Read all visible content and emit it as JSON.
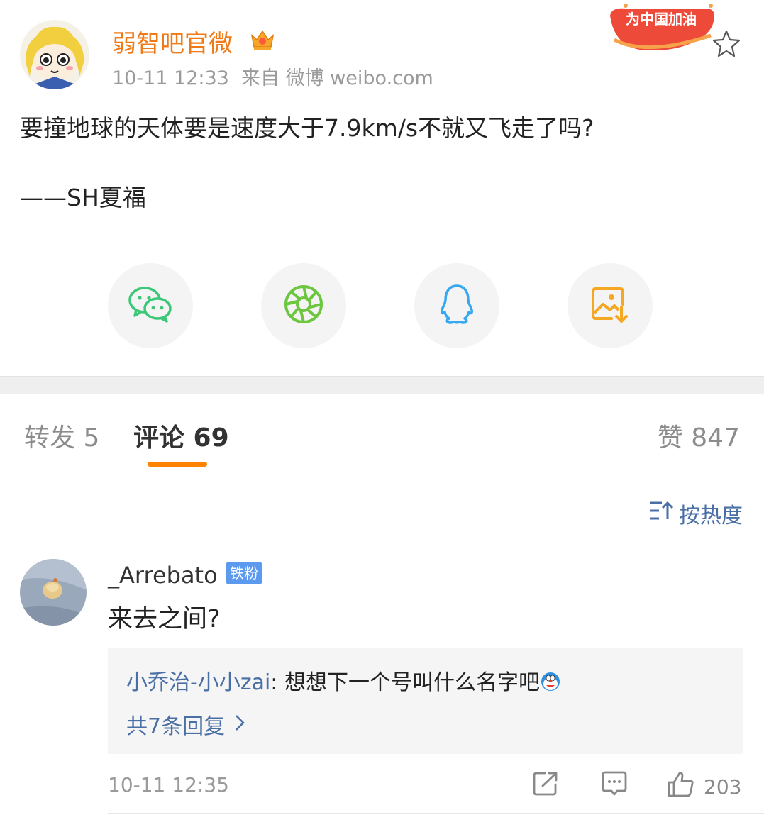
{
  "post": {
    "author": "弱智吧官微",
    "time": "10-11 12:33",
    "source": "来自 微博 weibo.com",
    "campaign_badge": "为中国加油",
    "text": "要撞地球的天体要是速度大于7.9km/s不就又飞走了吗?",
    "signature": "——SH夏福"
  },
  "share": [
    {
      "icon": "wechat-icon",
      "color": "#3cc878"
    },
    {
      "icon": "moments-icon",
      "color": "#6cc63f"
    },
    {
      "icon": "qq-icon",
      "color": "#36a8f0"
    },
    {
      "icon": "save-image-icon",
      "color": "#f5a623"
    }
  ],
  "tabs": {
    "repost": "转发 5",
    "comments": "评论 69",
    "likes": "赞 847"
  },
  "sort": {
    "label": "按热度"
  },
  "comment": {
    "user": "_Arrebato",
    "badge": "铁粉",
    "text": "来去之间?",
    "reply": {
      "user": "小乔治-小小zai",
      "separator": ": ",
      "text": "想想下一个号叫什么名字吧"
    },
    "reply_count": "共7条回复",
    "time": "10-11 12:35",
    "like_count": "203"
  },
  "colors": {
    "accent_orange": "#ff8200",
    "author_orange": "#f07a18",
    "link_blue": "#4a6fa5",
    "badge_blue": "#5c9af0"
  }
}
